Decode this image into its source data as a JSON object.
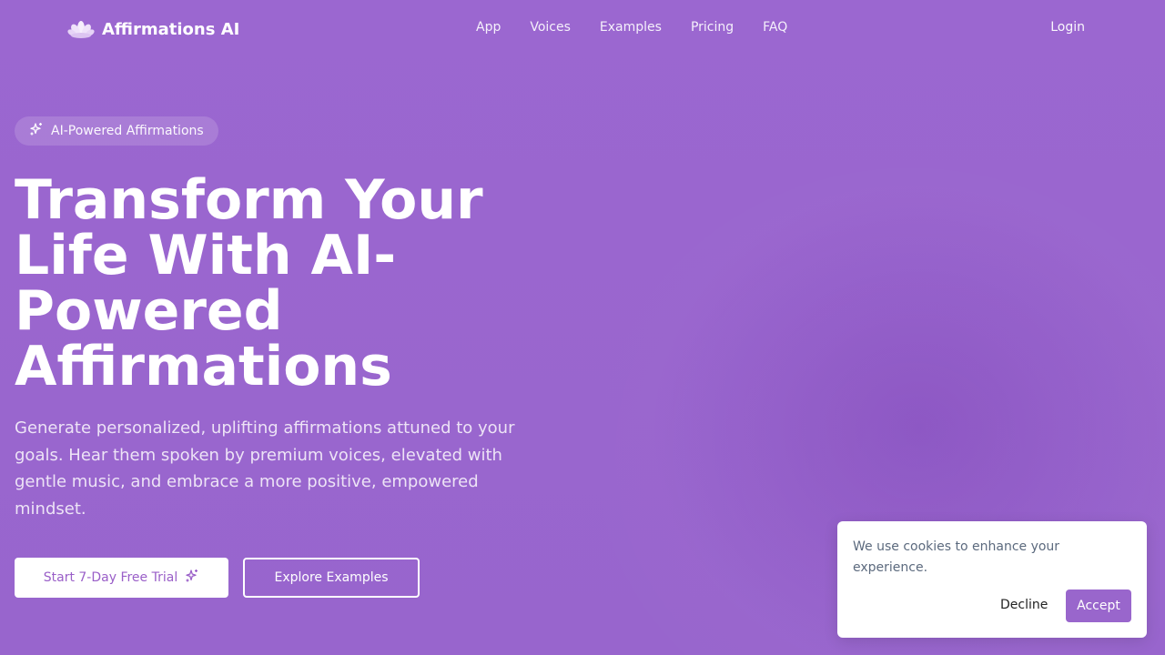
{
  "brand": {
    "name": "Affirmations AI",
    "logo_icon": "lotus-icon"
  },
  "nav": {
    "links": [
      "App",
      "Voices",
      "Examples",
      "Pricing",
      "FAQ"
    ],
    "login": "Login"
  },
  "hero": {
    "badge": {
      "icon": "sparkles-icon",
      "label": "AI-Powered Affirmations"
    },
    "title": "Transform Your Life With AI-Powered Affirmations",
    "subtitle": "Generate personalized, uplifting affirmations attuned to your goals. Hear them spoken by premium voices, elevated with gentle music, and embrace a more positive, empowered mindset.",
    "cta_primary": {
      "label": "Start 7-Day Free Trial",
      "icon": "sparkles-icon"
    },
    "cta_secondary": {
      "label": "Explore Examples"
    }
  },
  "cookie": {
    "text": "We use cookies to enhance your experience.",
    "decline": "Decline",
    "accept": "Accept"
  },
  "colors": {
    "background": "#9966cc",
    "accent": "#9966cc",
    "white": "#ffffff"
  }
}
